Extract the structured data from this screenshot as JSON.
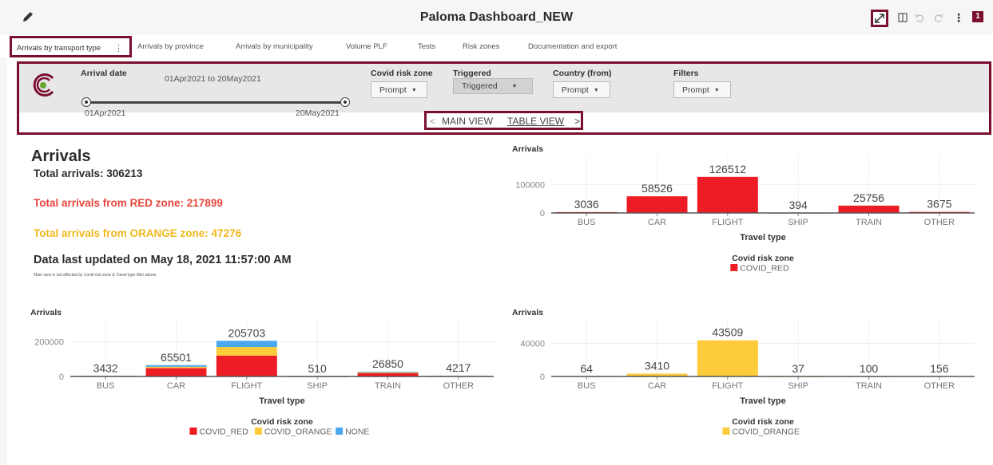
{
  "header": {
    "title": "Paloma Dashboard_NEW",
    "badge_count": "1"
  },
  "tabs": [
    {
      "label": "Arrivals by transport type",
      "active": true
    },
    {
      "label": "Arrivals by province"
    },
    {
      "label": "Arrivals by municipality"
    },
    {
      "label": "Volume PLF"
    },
    {
      "label": "Tests"
    },
    {
      "label": "Risk zones"
    },
    {
      "label": "Documentation and export"
    }
  ],
  "filters": {
    "arrival_date_label": "Arrival date",
    "arrival_range_text": "01Apr2021 to 20May2021",
    "slider_min": "01Apr2021",
    "slider_max": "20May2021",
    "covid_zone_label": "Covid risk zone",
    "covid_zone_value": "Prompt",
    "triggered_label": "Triggered",
    "triggered_value": "Triggered",
    "country_label": "Country (from)",
    "country_value": "Prompt",
    "filters_label": "Filters",
    "filters_value": "Prompt"
  },
  "view_nav": {
    "prev": "<",
    "main": "MAIN VIEW",
    "table": "TABLE VIEW",
    "next": ">"
  },
  "summary": {
    "heading": "Arrivals",
    "total": "Total arrivals: 306213",
    "red": "Total arrivals from RED zone: 217899",
    "orange": "Total arrivals from ORANGE zone: 47276",
    "updated": "Data last updated on May 18, 2021 11:57:00 AM",
    "note": "Main view is not affected by Covid risk zone & Travel type filter above."
  },
  "colors": {
    "red": "#ee1c24",
    "orange": "#fecb3b",
    "none": "#4aa8ee",
    "accent": "#7a0f2e"
  },
  "chart_data": [
    {
      "type": "bar",
      "title": "Arrivals",
      "categories": [
        "BUS",
        "CAR",
        "FLIGHT",
        "SHIP",
        "TRAIN",
        "OTHER"
      ],
      "xlabel": "Travel type",
      "ylim": [
        0,
        140000
      ],
      "yticks": [
        0,
        100000
      ],
      "series": [
        {
          "name": "COVID_RED",
          "values": [
            3036,
            58526,
            126512,
            394,
            25756,
            3675
          ]
        }
      ],
      "value_labels": [
        "3036",
        "58526",
        "126512",
        "394",
        "25756",
        "3675"
      ],
      "legend_title": "Covid risk zone"
    },
    {
      "type": "bar",
      "stacked": true,
      "title": "Arrivals",
      "categories": [
        "BUS",
        "CAR",
        "FLIGHT",
        "SHIP",
        "TRAIN",
        "OTHER"
      ],
      "xlabel": "Travel type",
      "ylim": [
        0,
        230000
      ],
      "yticks": [
        0,
        200000
      ],
      "series": [
        {
          "name": "COVID_RED",
          "values": [
            2500,
            48000,
            120000,
            300,
            20000,
            2500
          ]
        },
        {
          "name": "COVID_ORANGE",
          "values": [
            300,
            8000,
            50000,
            100,
            3500,
            1000
          ]
        },
        {
          "name": "NONE",
          "values": [
            632,
            9501,
            35703,
            110,
            3350,
            717
          ]
        }
      ],
      "value_labels": [
        "3432",
        "65501",
        "205703",
        "510",
        "26850",
        "4217"
      ],
      "legend_title": "Covid risk zone"
    },
    {
      "type": "bar",
      "title": "Arrivals",
      "categories": [
        "BUS",
        "CAR",
        "FLIGHT",
        "SHIP",
        "TRAIN",
        "OTHER"
      ],
      "xlabel": "Travel type",
      "ylim": [
        0,
        48000
      ],
      "yticks": [
        0,
        40000
      ],
      "series": [
        {
          "name": "COVID_ORANGE",
          "values": [
            64,
            3410,
            43509,
            37,
            100,
            156
          ]
        }
      ],
      "value_labels": [
        "64",
        "3410",
        "43509",
        "37",
        "100",
        "156"
      ],
      "legend_title": "Covid risk zone"
    }
  ]
}
